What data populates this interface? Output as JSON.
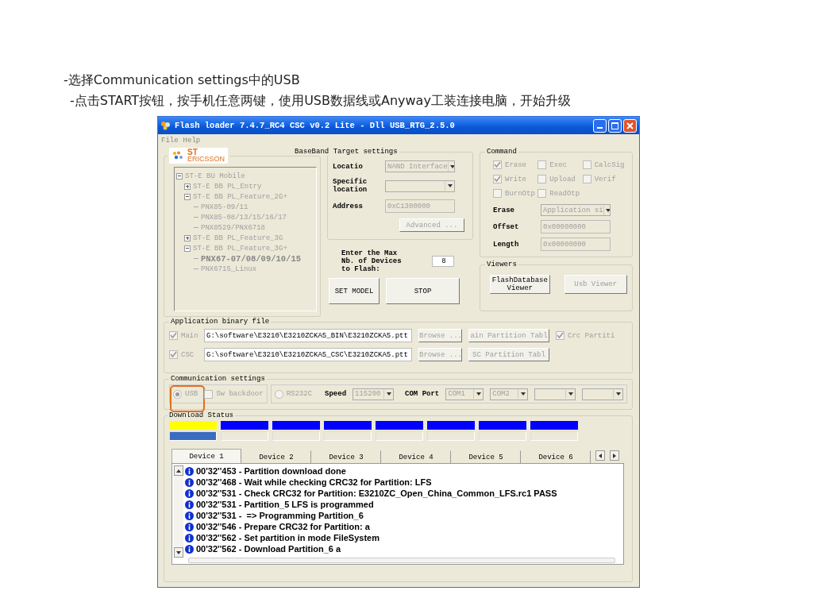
{
  "slide_text": [
    "-选择Communication settings中的USB",
    "-点击START按钮，按手机任意两键，使用USB数据线或Anyway工装连接电脑，开始升级"
  ],
  "window": {
    "title": "Flash loader 7.4.7_RC4 CSC v0.2 Lite - Dll USB_RTG_2.5.0"
  },
  "menu": [
    {
      "label": "File"
    },
    {
      "label": "Help"
    }
  ],
  "logo": {
    "line1": "ST",
    "line2": "ERICSSON"
  },
  "tree": [
    {
      "label": "ST-E BU Mobile",
      "expanded": true,
      "selected": false,
      "children": [
        {
          "label": "ST-E BB PL_Entry",
          "expanded": false,
          "selected": false
        },
        {
          "label": "ST-E BB PL_Feature_2G+",
          "expanded": true,
          "selected": false,
          "children": [
            {
              "label": "PNX85-09/11",
              "selected": false
            },
            {
              "label": "PNX85-08/13/15/16/17",
              "selected": false
            },
            {
              "label": "PNX8529/PNX6718",
              "selected": false
            }
          ]
        },
        {
          "label": "ST-E BB PL_Feature_3G",
          "expanded": false,
          "selected": false
        },
        {
          "label": "ST-E BB PL_Feature_3G+",
          "expanded": true,
          "selected": false,
          "children": [
            {
              "label": "PNX67-07/08/09/10/15",
              "selected": true
            },
            {
              "label": "PNX6715_Linux",
              "selected": false
            }
          ]
        }
      ]
    }
  ],
  "target_settings": {
    "prefix": "BaseBand",
    "title": "Target settings",
    "fields": [
      {
        "label": "Locatio",
        "kind": "select",
        "value": "NAND Interface"
      },
      {
        "label": "Specific location",
        "kind": "select"
      },
      {
        "label": "Address",
        "kind": "text",
        "value": "0xC1300000"
      }
    ],
    "button": "Advanced ..."
  },
  "max_devices": {
    "label": "Enter the Max Nb. of Devices to Flash:",
    "value": "8"
  },
  "buttons": [
    "SET MODEL",
    "STOP"
  ],
  "command": {
    "title": "Command",
    "checkboxes": [
      {
        "label": "Erase",
        "checked": true
      },
      {
        "label": "Exec",
        "checked": false
      },
      {
        "label": "CalcSig",
        "checked": false
      },
      {
        "label": "Write",
        "checked": true
      },
      {
        "label": "Upload",
        "checked": false
      },
      {
        "label": "Verif",
        "checked": false
      },
      {
        "label": "BurnOtp",
        "checked": false
      },
      {
        "label": "ReadOtp",
        "checked": false
      }
    ],
    "fields": [
      {
        "label": "Erase",
        "kind": "select",
        "value": "Application si"
      },
      {
        "label": "Offset",
        "kind": "text",
        "value": "0x00000000"
      },
      {
        "label": "Length",
        "kind": "text",
        "value": "0x00000000"
      }
    ]
  },
  "viewers": {
    "title": "Viewers",
    "buttons": [
      {
        "label": "FlashDatabase Viewer",
        "disabled": false
      },
      {
        "label": "Usb Viewer",
        "disabled": true
      }
    ]
  },
  "app_binary": {
    "title": "Application binary file",
    "rows": [
      {
        "label": "Main",
        "checked": true,
        "path": "G:\\software\\E3210\\E3210ZCKA5_BIN\\E3210ZCKA5.ptt",
        "browse": "Browse ...",
        "table": "ain Partition Tabl"
      },
      {
        "label": "CSC",
        "checked": true,
        "path": "G:\\software\\E3210\\E3210ZCKA5_CSC\\E3210ZCKA5.ptt",
        "browse": "Browse ...",
        "table": "SC Partition Tabl"
      }
    ],
    "crc": {
      "label": "Crc Partiti",
      "checked": true
    }
  },
  "comm": {
    "title": "Communication settings",
    "options": [
      {
        "label": "USB",
        "kind": "radio",
        "selected": true,
        "highlighted": true
      },
      {
        "label": "Sw backdoor",
        "kind": "checkbox",
        "checked": false,
        "highlighted": false
      },
      {
        "label": "RS232C",
        "kind": "radio",
        "selected": false,
        "highlighted": false
      }
    ],
    "speed": {
      "label": "Speed",
      "value": "115200"
    },
    "com_port": {
      "label": "COM Port",
      "selects": [
        {
          "kind": "filled",
          "value": "COM1"
        },
        {
          "kind": "filled",
          "value": "COM2"
        },
        {
          "kind": "blank"
        },
        {
          "kind": "blank"
        }
      ]
    }
  },
  "download": {
    "title": "Download Status",
    "devices": [
      {
        "color": "#ffff00",
        "level": 1
      },
      {
        "color": "#0000ff",
        "level": 0
      },
      {
        "color": "#0000ff",
        "level": 0
      },
      {
        "color": "#0000ff",
        "level": 0
      },
      {
        "color": "#0000ff",
        "level": 0
      },
      {
        "color": "#0000ff",
        "level": 0
      },
      {
        "color": "#0000ff",
        "level": 0
      },
      {
        "color": "#0000ff",
        "level": 0
      }
    ],
    "tabs": [
      {
        "label": "Device 1",
        "selected": true
      },
      {
        "label": "Device 2",
        "selected": false
      },
      {
        "label": "Device 3",
        "selected": false
      },
      {
        "label": "Device 4",
        "selected": false
      },
      {
        "label": "Device 5",
        "selected": false
      },
      {
        "label": "Device 6",
        "selected": false
      }
    ],
    "log": [
      "00'32''453 - Partition download done",
      "00'32''468 - Wait while checking CRC32 for Partition: LFS",
      "00'32''531 - Check CRC32 for Partition: E3210ZC_Open_China_Common_LFS.rc1 PASS",
      "00'32''531 - Partition_5 LFS is programmed",
      "00'32''531 -  => Programming Partition_6",
      "00'32''546 - Prepare CRC32 for Partition: a",
      "00'32''562 - Set partition in mode FileSystem",
      "00'32''562 - Download Partition_6 a"
    ]
  }
}
